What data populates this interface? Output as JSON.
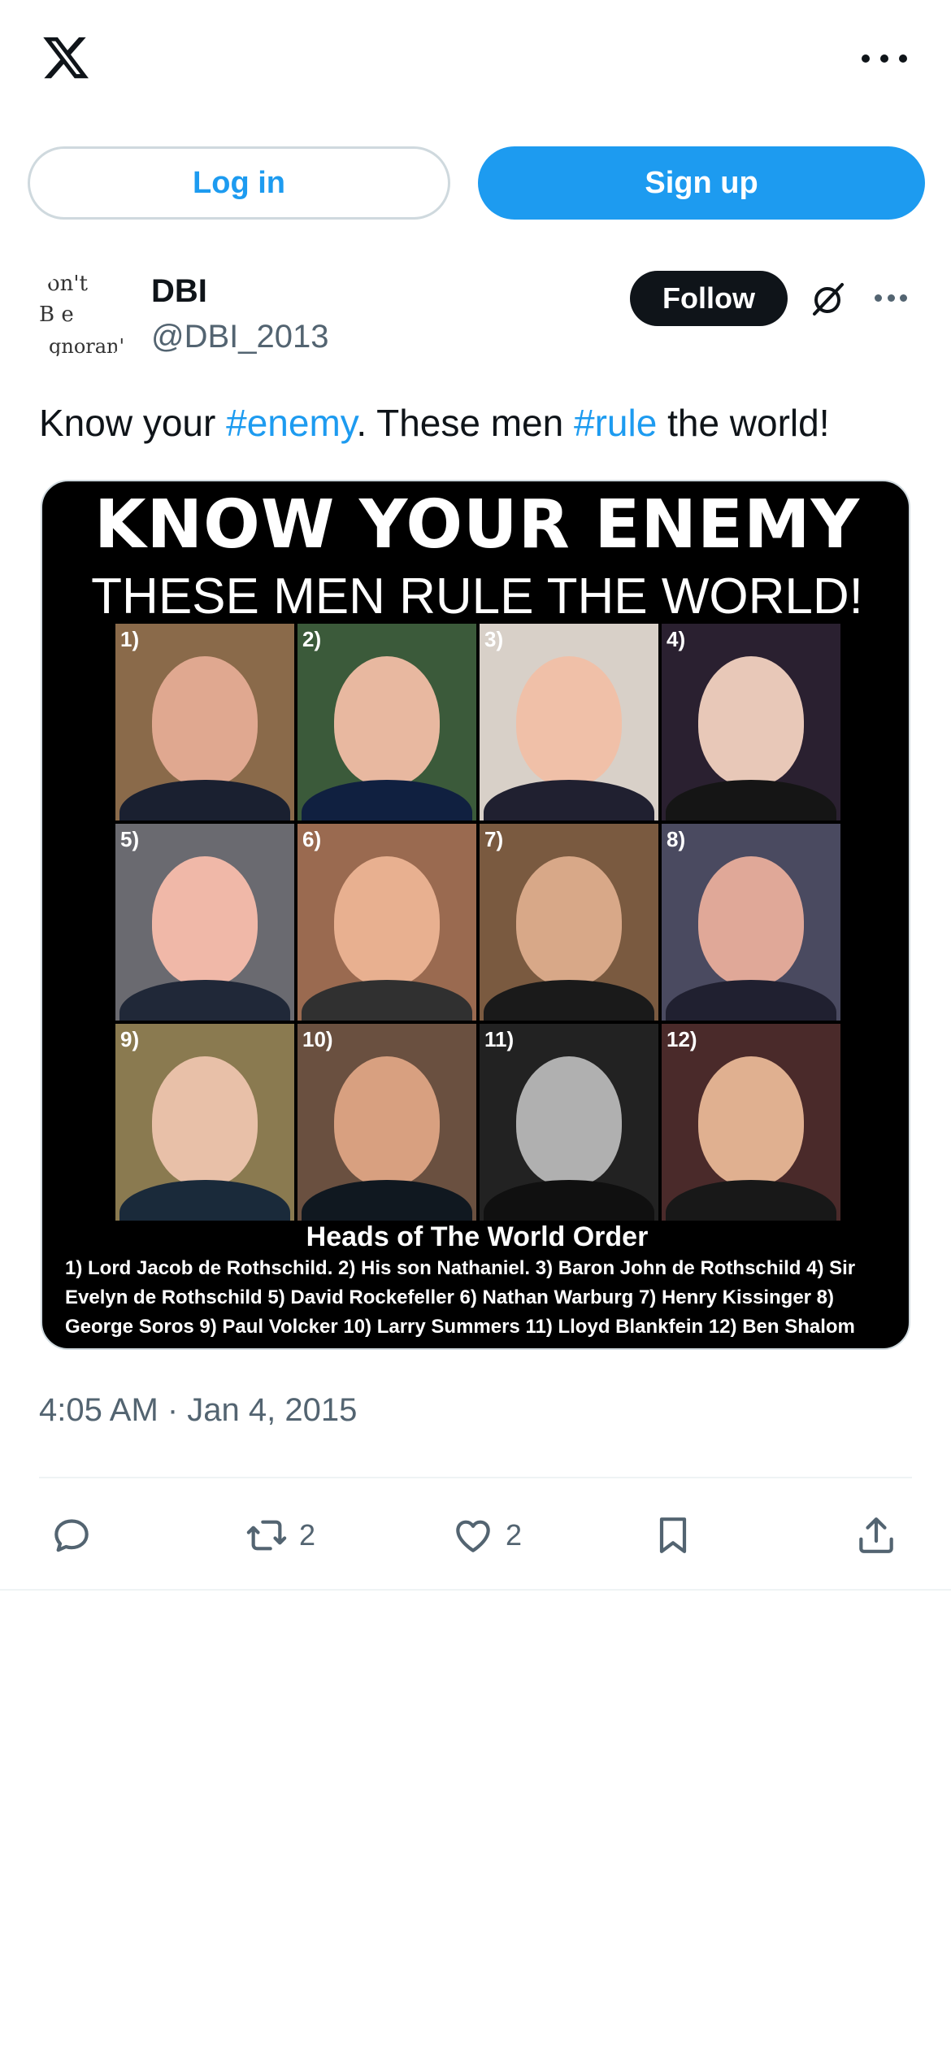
{
  "header": {
    "logo_icon": "x-logo-icon",
    "more_icon": "more-icon"
  },
  "auth": {
    "login_label": "Log in",
    "signup_label": "Sign up"
  },
  "post": {
    "avatar_text": [
      "on't",
      "B e",
      "gnoran'"
    ],
    "display_name": "DBI",
    "handle": "@DBI_2013",
    "follow_label": "Follow",
    "text_parts": [
      "Know your ",
      "#enemy",
      ". These men ",
      "#rule",
      " the world!"
    ],
    "media": {
      "headline": "KNOW YOUR ENEMY",
      "subheadline": "THESE MEN RULE THE WORLD!",
      "numbers": [
        "1)",
        "2)",
        "3)",
        "4)",
        "5)",
        "6)",
        "7)",
        "8)",
        "9)",
        "10)",
        "11)",
        "12)"
      ],
      "caption_title": "Heads of The World Order",
      "caption_text": "1) Lord Jacob de Rothschild. 2) His son Nathaniel. 3) Baron John de Rothschild 4) Sir Evelyn de Rothschild 5) David Rockefeller 6) Nathan Warburg 7) Henry Kissinger 8) George Soros 9) Paul Volcker 10) Larry Summers 11) Lloyd Blankfein 12) Ben Shalom"
    },
    "timestamp": "4:05 AM · Jan 4, 2015",
    "actions": {
      "reply_count": "",
      "repost_count": "2",
      "like_count": "2"
    }
  },
  "colors": {
    "accent": "#1d9bf0",
    "text": "#0f1419",
    "secondary": "#536471",
    "border": "#cfd9de"
  }
}
